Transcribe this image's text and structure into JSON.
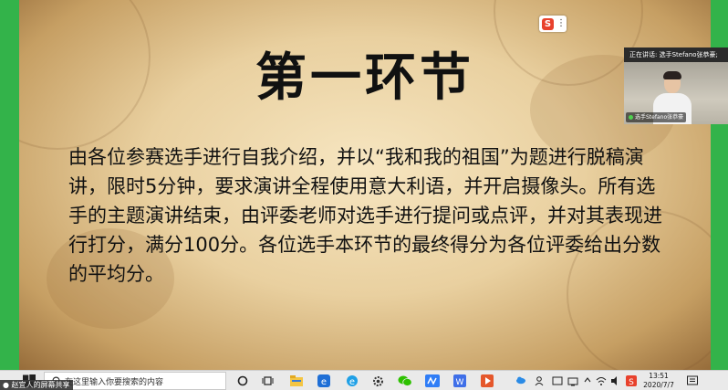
{
  "slide": {
    "title": "第一环节",
    "body": "由各位参赛选手进行自我介绍，并以“我和我的祖国”为题进行脱稿演讲，限时5分钟，要求演讲全程使用意大利语，并开启摄像头。所有选手的主题演讲结束，由评委老师对选手进行提问或点评，并对其表现进行打分，满分100分。各位选手本环节的最终得分为各位评委给出分数的平均分。"
  },
  "ime_float": {
    "logo": "S",
    "menu": "⋮"
  },
  "video_panel": {
    "header": "正在讲话: 选手Stefano张恭豪;",
    "name_label": "选手Stefano张恭豪"
  },
  "share_badge": "赵宜人的屏幕共享",
  "taskbar": {
    "search_placeholder": "在这里输入你要搜索的内容",
    "time": "13:51",
    "date": "2020/7/7",
    "ime_label": "中",
    "icons": [
      "windows-start-icon",
      "search-icon",
      "cortana-icon",
      "task-view-icon",
      "file-explorer-icon",
      "edge-legacy-icon",
      "ie-icon",
      "settings-icon",
      "wechat-icon",
      "tencent-meeting-icon",
      "wps-icon",
      "media-player-icon"
    ],
    "tray_icons": [
      "cloud-icon",
      "people-icon",
      "network-icon",
      "volume-icon",
      "ime-icon",
      "notification-icon"
    ]
  },
  "colors": {
    "frame_green": "#33b34a",
    "title_color": "#111111",
    "parchment": "#e8cf9c"
  }
}
